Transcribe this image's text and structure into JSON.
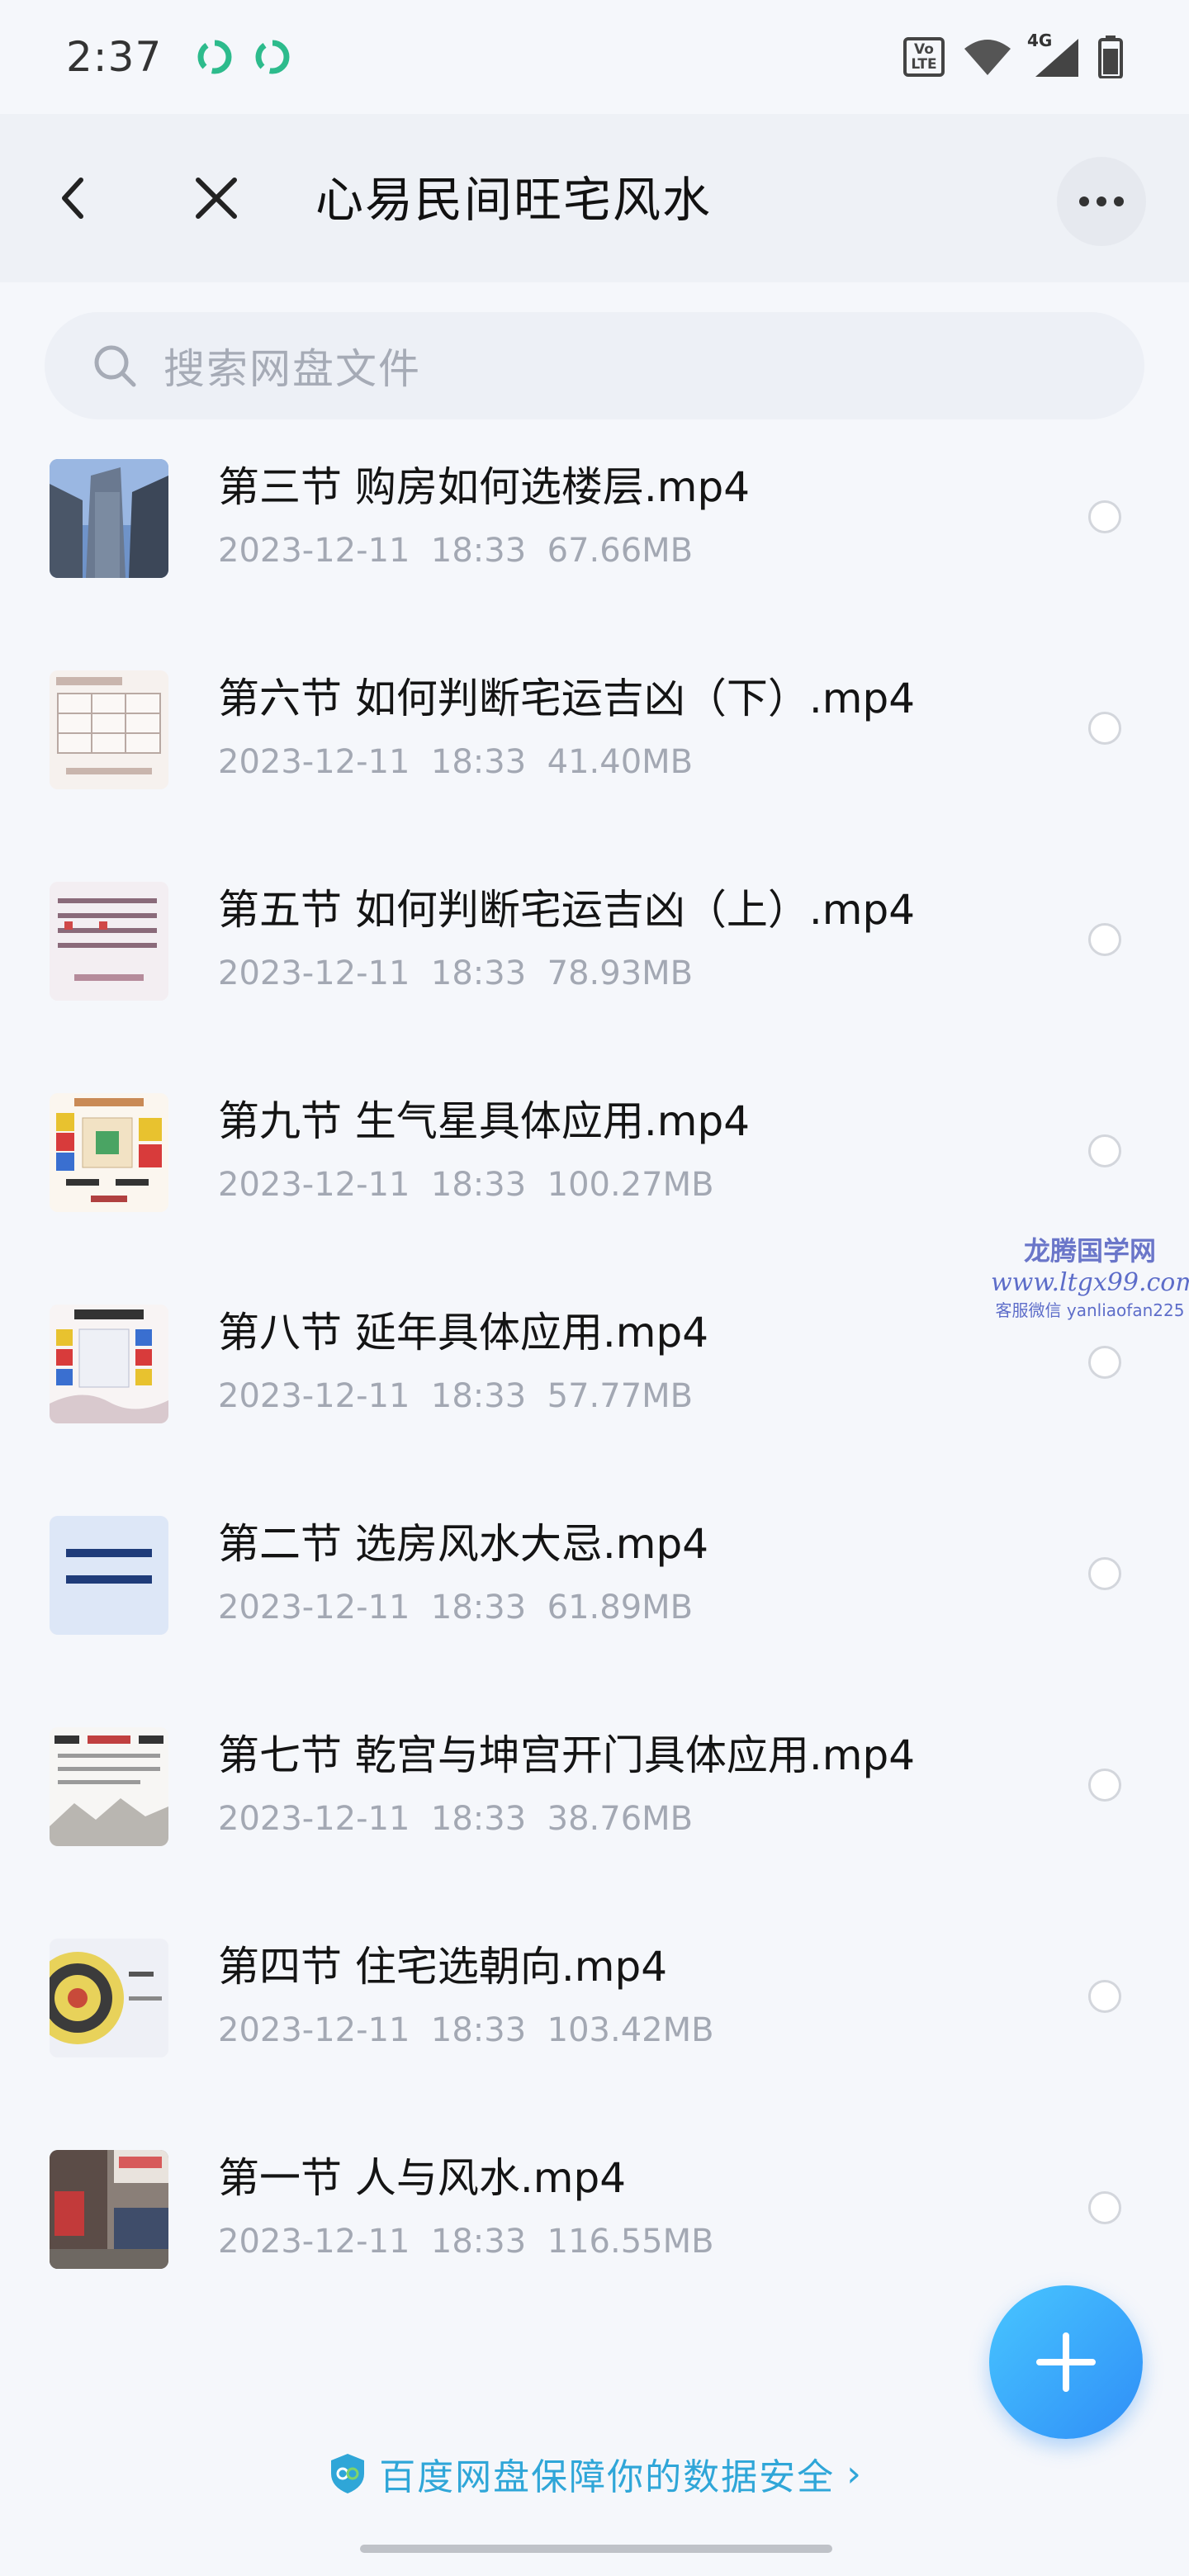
{
  "status_bar": {
    "time": "2:37",
    "volte_line1": "Vo",
    "volte_line2": "LTE",
    "network": "4G"
  },
  "header": {
    "title": "心易民间旺宅风水"
  },
  "search": {
    "placeholder": "搜索网盘文件"
  },
  "files": [
    {
      "name": "第三节 购房如何选楼层.mp4",
      "date": "2023-12-11",
      "time": "18:33",
      "size": "67.66MB",
      "thumb": "buildings"
    },
    {
      "name": "第六节 如何判断宅运吉凶（下）.mp4",
      "date": "2023-12-11",
      "time": "18:33",
      "size": "41.40MB",
      "thumb": "grid-chart"
    },
    {
      "name": "第五节 如何判断宅运吉凶（上）.mp4",
      "date": "2023-12-11",
      "time": "18:33",
      "size": "78.93MB",
      "thumb": "text-slide"
    },
    {
      "name": "第九节 生气星具体应用.mp4",
      "date": "2023-12-11",
      "time": "18:33",
      "size": "100.27MB",
      "thumb": "color-grid"
    },
    {
      "name": "第八节 延年具体应用.mp4",
      "date": "2023-12-11",
      "time": "18:33",
      "size": "57.77MB",
      "thumb": "color-blocks"
    },
    {
      "name": "第二节 选房风水大忌.mp4",
      "date": "2023-12-11",
      "time": "18:33",
      "size": "61.89MB",
      "thumb": "blue-slide"
    },
    {
      "name": "第七节 乾宫与坤宫开门具体应用.mp4",
      "date": "2023-12-11",
      "time": "18:33",
      "size": "38.76MB",
      "thumb": "landscape"
    },
    {
      "name": "第四节 住宅选朝向.mp4",
      "date": "2023-12-11",
      "time": "18:33",
      "size": "103.42MB",
      "thumb": "compass"
    },
    {
      "name": "第一节 人与风水.mp4",
      "date": "2023-12-11",
      "time": "18:33",
      "size": "116.55MB",
      "thumb": "storefront"
    }
  ],
  "watermark": {
    "line1": "龙腾国学网",
    "line2": "www.ltgx99.com",
    "line3": "客服微信 yanliaofan225"
  },
  "footer": {
    "text": "百度网盘保障你的数据安全",
    "chevron": "›"
  },
  "colors": {
    "accent": "#2f8ef7",
    "footer_text": "#2fa6d8",
    "app_icon_green": "#2dbb8c"
  }
}
